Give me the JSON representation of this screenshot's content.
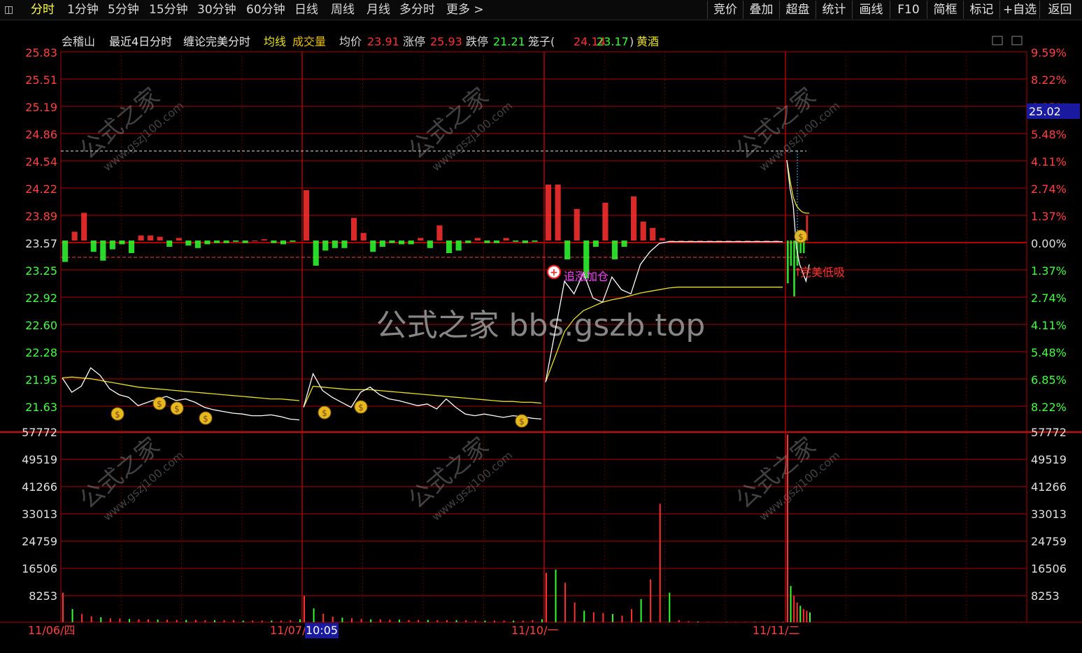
{
  "toolbar": {
    "periods": [
      {
        "label": "分时",
        "active": true
      },
      {
        "label": "1分钟"
      },
      {
        "label": "5分钟"
      },
      {
        "label": "15分钟"
      },
      {
        "label": "30分钟"
      },
      {
        "label": "60分钟"
      },
      {
        "label": "日线"
      },
      {
        "label": "周线"
      },
      {
        "label": "月线"
      },
      {
        "label": "多分时"
      },
      {
        "label": "更多 >"
      }
    ],
    "actions": [
      "竞价",
      "叠加",
      "超盘",
      "统计",
      "画线",
      "F10",
      "简框",
      "标记",
      "+自选",
      "返回"
    ]
  },
  "header": {
    "stock": "会稽山",
    "mode": "最近4日分时",
    "indicator": "缠论完美分时",
    "avg_line": "均线",
    "volume_label": "成交量",
    "avg_price_label": "均价",
    "avg_price": "23.91",
    "limit_up_label": "涨停",
    "limit_up": "25.93",
    "limit_down_label": "跌停",
    "limit_down": "21.21",
    "cage_label": "笼子(",
    "cage_high": "24.14",
    "cage_low": "23.17",
    "cage_close": ")",
    "sector": "黄酒"
  },
  "price_axis_left": [
    "25.83",
    "25.51",
    "25.19",
    "24.86",
    "24.54",
    "24.22",
    "23.89",
    "23.57",
    "23.25",
    "22.92",
    "22.60",
    "22.28",
    "21.95",
    "21.63"
  ],
  "pct_axis_right": [
    "9.59%",
    "8.22%",
    "6.85%",
    "5.48%",
    "4.11%",
    "2.74%",
    "1.37%",
    "0.00%",
    "1.37%",
    "2.74%",
    "4.11%",
    "5.48%",
    "6.85%",
    "8.22%"
  ],
  "volume_axis": [
    "57772",
    "49519",
    "41266",
    "33013",
    "24759",
    "16506",
    "8253"
  ],
  "current_price_tag": "25.02",
  "dates": [
    "11/06/四",
    "11/07/",
    "11/10/一",
    "11/11/二"
  ],
  "cursor_time": "10:05",
  "signals": {
    "add": "追涨加仓",
    "buy": "完美低吸"
  },
  "watermarks": {
    "center": "公式之家 bbs.gszb.top",
    "diag_a": "公式之家",
    "diag_b": "www.gszj100.com"
  },
  "colors": {
    "up": "#ff3030",
    "down": "#30ff30",
    "grid": "#b00000",
    "price_line": "#ffffff",
    "avg_line": "#e8e020",
    "axis_text_red": "#ff4040",
    "axis_text_green": "#40ff40"
  },
  "chart_data": {
    "type": "line",
    "base_price": 23.57,
    "days": [
      {
        "date": "11/06/四",
        "price": [
          21.95,
          21.78,
          21.85,
          22.07,
          21.98,
          21.82,
          21.75,
          21.72,
          21.62,
          21.66,
          21.7,
          21.73,
          21.68,
          21.7,
          21.66,
          21.6,
          21.57,
          21.55,
          21.53,
          21.52,
          21.5,
          21.5,
          21.51,
          21.49,
          21.46,
          21.45
        ],
        "avg": [
          21.95,
          21.96,
          21.95,
          21.94,
          21.92,
          21.9,
          21.88,
          21.86,
          21.84,
          21.83,
          21.82,
          21.81,
          21.8,
          21.79,
          21.78,
          21.77,
          21.76,
          21.75,
          21.74,
          21.73,
          21.72,
          21.71,
          21.7,
          21.7,
          21.69,
          21.68
        ]
      },
      {
        "date": "11/07/",
        "price": [
          21.6,
          22.0,
          21.8,
          21.72,
          21.66,
          21.6,
          21.78,
          21.84,
          21.75,
          21.7,
          21.68,
          21.65,
          21.62,
          21.64,
          21.58,
          21.7,
          21.6,
          21.52,
          21.5,
          21.52,
          21.5,
          21.48,
          21.5,
          21.49,
          21.47,
          21.46
        ],
        "avg": [
          21.6,
          21.85,
          21.84,
          21.83,
          21.82,
          21.81,
          21.81,
          21.81,
          21.8,
          21.79,
          21.78,
          21.77,
          21.76,
          21.75,
          21.74,
          21.73,
          21.72,
          21.71,
          21.7,
          21.69,
          21.68,
          21.67,
          21.67,
          21.66,
          21.66,
          21.65
        ]
      },
      {
        "date": "11/10/一",
        "price": [
          21.9,
          22.5,
          23.1,
          22.95,
          23.2,
          22.9,
          22.85,
          23.15,
          23.0,
          22.95,
          23.3,
          23.45,
          23.55,
          23.57,
          23.57,
          23.57,
          23.57,
          23.57,
          23.57,
          23.57,
          23.57,
          23.57,
          23.57,
          23.57,
          23.57,
          23.57
        ],
        "avg": [
          21.9,
          22.2,
          22.5,
          22.65,
          22.75,
          22.8,
          22.85,
          22.88,
          22.9,
          22.93,
          22.96,
          22.98,
          23.0,
          23.02,
          23.03,
          23.03,
          23.03,
          23.03,
          23.03,
          23.03,
          23.03,
          23.03,
          23.03,
          23.03,
          23.03,
          23.03
        ]
      },
      {
        "date": "11/11/二",
        "price": [
          24.54,
          24.2,
          24.0,
          23.5,
          23.3,
          23.2,
          23.1,
          23.3
        ],
        "avg": [
          24.54,
          24.3,
          24.1,
          24.0,
          23.95,
          23.92,
          23.91,
          23.91
        ]
      }
    ],
    "volume": [
      {
        "date": "11/06/四",
        "values": [
          9000,
          4000,
          2500,
          1800,
          1500,
          1200,
          1100,
          1000,
          900,
          900,
          800,
          800,
          700,
          700,
          700,
          600,
          600,
          600,
          600,
          500,
          500,
          500,
          500,
          500,
          600,
          900
        ]
      },
      {
        "date": "11/07/",
        "values": [
          8000,
          4200,
          2600,
          1700,
          1400,
          1200,
          1000,
          900,
          900,
          800,
          800,
          700,
          700,
          700,
          600,
          600,
          600,
          600,
          500,
          500,
          500,
          500,
          500,
          500,
          600,
          900
        ]
      },
      {
        "date": "11/10/一",
        "values": [
          15000,
          16000,
          12000,
          6000,
          3500,
          3000,
          2800,
          2500,
          2000,
          4000,
          7000,
          13000,
          36000,
          9000,
          600,
          300,
          200,
          100,
          100,
          100,
          100,
          100,
          100,
          100,
          100,
          100
        ]
      },
      {
        "date": "11/11/二",
        "values": [
          57000,
          11000,
          8000,
          6000,
          5000,
          4000,
          3500,
          3000
        ]
      }
    ]
  }
}
